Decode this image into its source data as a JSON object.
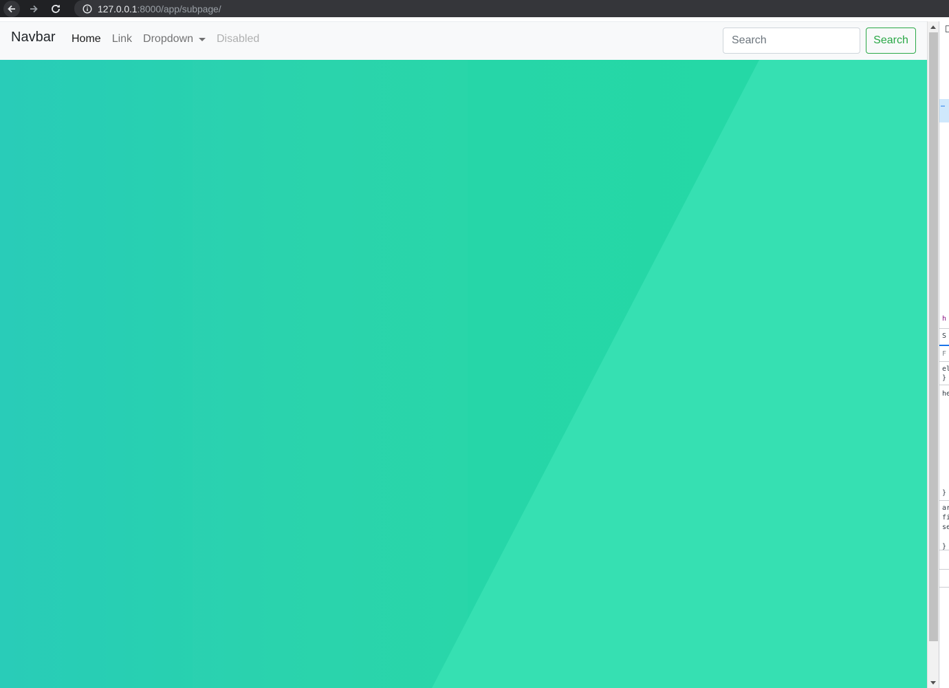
{
  "browser": {
    "url_host": "127.0.0.1",
    "url_rest": ":8000/app/subpage/"
  },
  "navbar": {
    "brand": "Navbar",
    "links": [
      {
        "label": "Home",
        "state": "active"
      },
      {
        "label": "Link",
        "state": "normal"
      },
      {
        "label": "Dropdown",
        "state": "dropdown"
      },
      {
        "label": "Disabled",
        "state": "disabled"
      }
    ],
    "search_placeholder": "Search",
    "search_button": "Search"
  },
  "devtools": {
    "fragments": [
      "h",
      "S",
      "F",
      "el",
      "}",
      "he",
      "}",
      "ar",
      "fi",
      "se",
      "}"
    ]
  },
  "colors": {
    "hero_left": "#29ccb8",
    "hero_right": "#24d9a4",
    "hero_accent": "#36e0b2",
    "success": "#28a745"
  }
}
